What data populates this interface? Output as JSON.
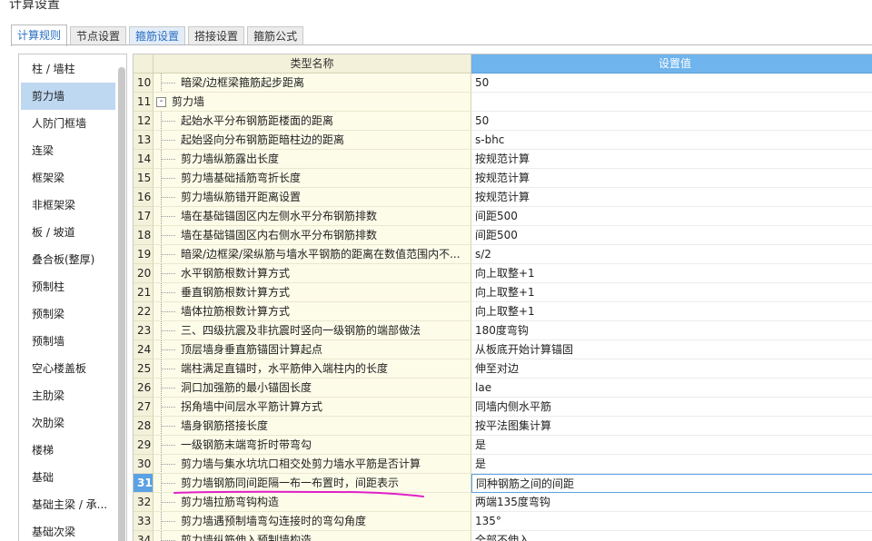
{
  "window": {
    "title": "计算设置"
  },
  "tabs": [
    {
      "label": "计算规则",
      "state": "active"
    },
    {
      "label": "节点设置",
      "state": "normal"
    },
    {
      "label": "箍筋设置",
      "state": "highlight"
    },
    {
      "label": "搭接设置",
      "state": "normal"
    },
    {
      "label": "箍筋公式",
      "state": "normal"
    }
  ],
  "sidebar": {
    "items": [
      {
        "label": "柱 / 墙柱"
      },
      {
        "label": "剪力墙",
        "selected": true
      },
      {
        "label": "人防门框墙"
      },
      {
        "label": "连梁"
      },
      {
        "label": "框架梁"
      },
      {
        "label": "非框架梁"
      },
      {
        "label": "板 / 坡道"
      },
      {
        "label": "叠合板(整厚)"
      },
      {
        "label": "预制柱"
      },
      {
        "label": "预制梁"
      },
      {
        "label": "预制墙"
      },
      {
        "label": "空心楼盖板"
      },
      {
        "label": "主肋梁"
      },
      {
        "label": "次肋梁"
      },
      {
        "label": "楼梯"
      },
      {
        "label": "基础"
      },
      {
        "label": "基础主梁 / 承..."
      },
      {
        "label": "基础次梁"
      }
    ]
  },
  "grid": {
    "header": {
      "name": "类型名称",
      "value": "设置值"
    },
    "rows": [
      {
        "num": "10",
        "name": "暗梁/边框梁箍筋起步距离",
        "value": "50"
      },
      {
        "num": "11",
        "name": "剪力墙",
        "value": "",
        "group": true,
        "expander": "-"
      },
      {
        "num": "12",
        "name": "起始水平分布钢筋距楼面的距离",
        "value": "50"
      },
      {
        "num": "13",
        "name": "起始竖向分布钢筋距暗柱边的距离",
        "value": "s-bhc"
      },
      {
        "num": "14",
        "name": "剪力墙纵筋露出长度",
        "value": "按规范计算"
      },
      {
        "num": "15",
        "name": "剪力墙基础插筋弯折长度",
        "value": "按规范计算"
      },
      {
        "num": "16",
        "name": "剪力墙纵筋错开距离设置",
        "value": "按规范计算"
      },
      {
        "num": "17",
        "name": "墙在基础锚固区内左侧水平分布钢筋排数",
        "value": "间距500"
      },
      {
        "num": "18",
        "name": "墙在基础锚固区内右侧水平分布钢筋排数",
        "value": "间距500"
      },
      {
        "num": "19",
        "name": "暗梁/边框梁/梁纵筋与墙水平钢筋的距离在数值范围内不...",
        "value": "s/2"
      },
      {
        "num": "20",
        "name": "水平钢筋根数计算方式",
        "value": "向上取整+1"
      },
      {
        "num": "21",
        "name": "垂直钢筋根数计算方式",
        "value": "向上取整+1"
      },
      {
        "num": "22",
        "name": "墙体拉筋根数计算方式",
        "value": "向上取整+1"
      },
      {
        "num": "23",
        "name": "三、四级抗震及非抗震时竖向一级钢筋的端部做法",
        "value": "180度弯钩"
      },
      {
        "num": "24",
        "name": "顶层墙身垂直筋锚固计算起点",
        "value": "从板底开始计算锚固"
      },
      {
        "num": "25",
        "name": "端柱满足直锚时，水平筋伸入端柱内的长度",
        "value": "伸至对边"
      },
      {
        "num": "26",
        "name": "洞口加强筋的最小锚固长度",
        "value": "lae"
      },
      {
        "num": "27",
        "name": "拐角墙中间层水平筋计算方式",
        "value": "同墙内侧水平筋"
      },
      {
        "num": "28",
        "name": "墙身钢筋搭接长度",
        "value": "按平法图集计算"
      },
      {
        "num": "29",
        "name": "一级钢筋末端弯折时带弯勾",
        "value": "是"
      },
      {
        "num": "30",
        "name": "剪力墙与集水坑坑口相交处剪力墙水平筋是否计算",
        "value": "是"
      },
      {
        "num": "31",
        "name": "剪力墙钢筋同间距隔一布一布置时，间距表示",
        "value": "同种钢筋之间的间距",
        "current": true
      },
      {
        "num": "32",
        "name": "剪力墙拉筋弯钩构造",
        "value": "两端135度弯钩"
      },
      {
        "num": "33",
        "name": "剪力墙遇预制墙弯勾连接时的弯勾角度",
        "value": "135°"
      },
      {
        "num": "34",
        "name": "剪力墙纵筋伸入预制墙构造",
        "value": "全部不伸入"
      }
    ]
  },
  "colors": {
    "accent": "#5aa2e3",
    "header_value_bg": "#6fb4ec",
    "name_col_bg": "#fdfce9",
    "selected_item_bg": "#bfd8f2",
    "annotation": "#e020c8"
  }
}
